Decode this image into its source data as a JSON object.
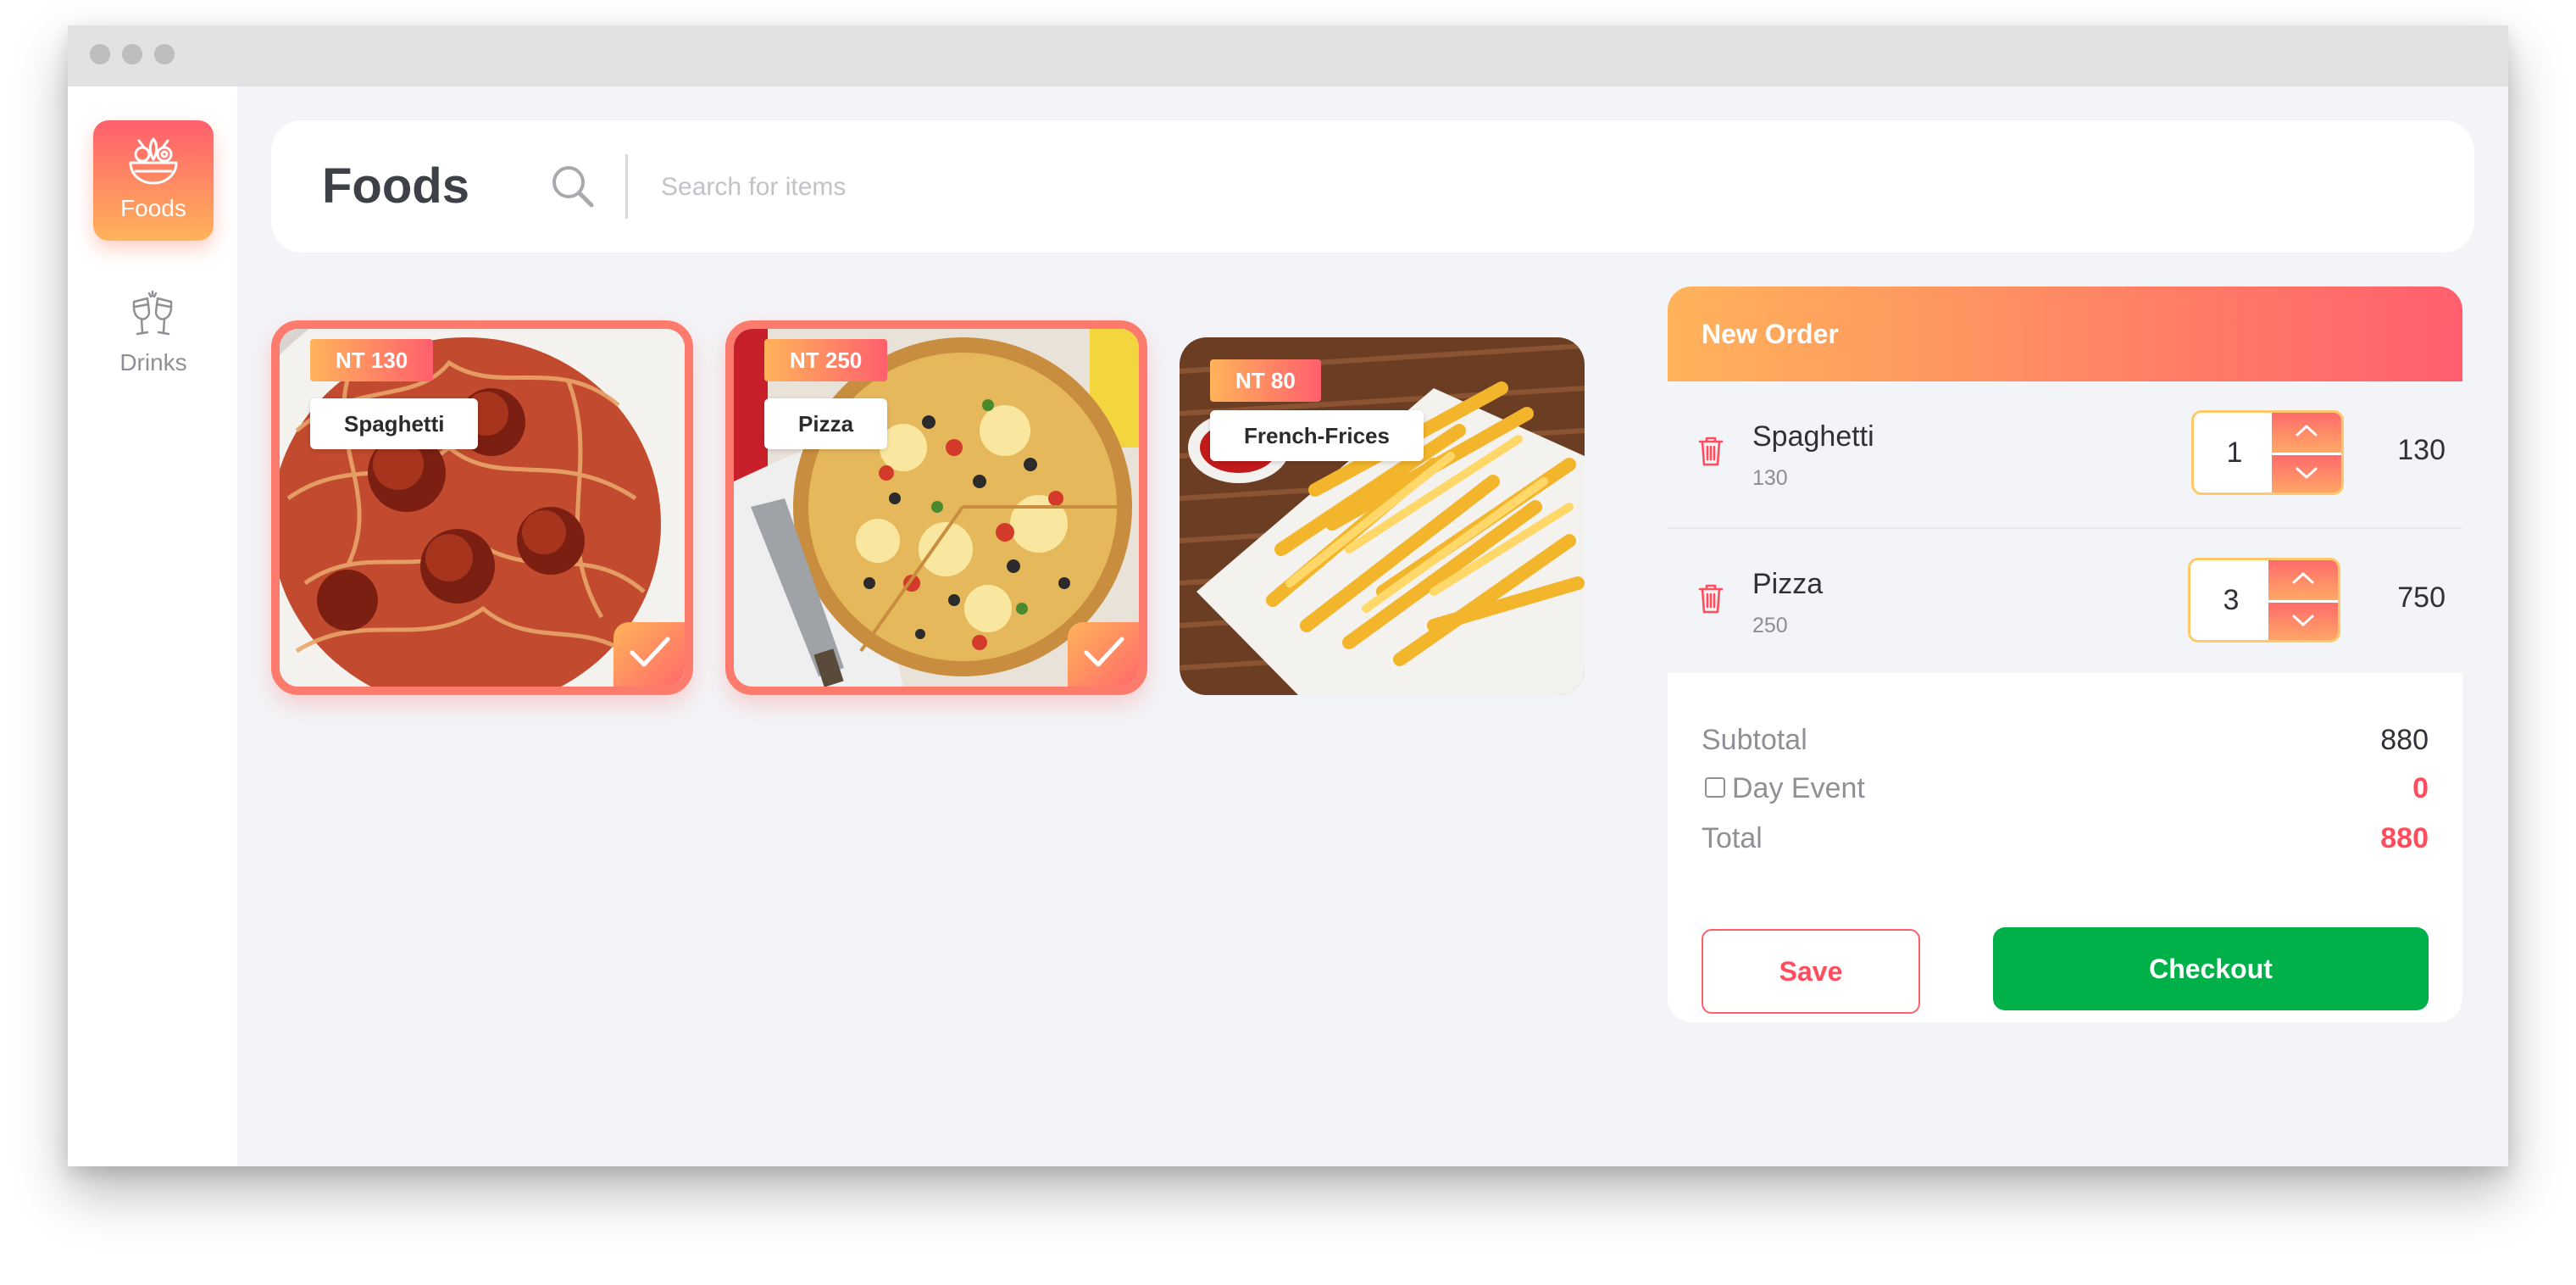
{
  "window": {
    "controls": [
      "close-dot",
      "minimize-dot",
      "maximize-dot"
    ]
  },
  "sidebar": {
    "items": [
      {
        "label": "Foods",
        "icon": "salad-bowl-icon",
        "active": true
      },
      {
        "label": "Drinks",
        "icon": "wine-glasses-icon",
        "active": false
      }
    ]
  },
  "header": {
    "title": "Foods",
    "search_placeholder": "Search for items",
    "search_icon": "search-icon"
  },
  "foods": [
    {
      "price": "NT 130",
      "name": "Spaghetti",
      "selected": true
    },
    {
      "price": "NT 250",
      "name": "Pizza",
      "selected": true
    },
    {
      "price": "NT 80",
      "name": "French-Frices",
      "selected": false
    }
  ],
  "order": {
    "title": "New Order",
    "items": [
      {
        "name": "Spaghetti",
        "unit_price": "130",
        "quantity": "1",
        "total": "130"
      },
      {
        "name": "Pizza",
        "unit_price": "250",
        "quantity": "3",
        "total": "750"
      }
    ],
    "subtotal_label": "Subtotal",
    "subtotal": "880",
    "day_event_label": "Day Event",
    "day_event_value": "0",
    "day_event_checked": false,
    "total_label": "Total",
    "total": "880",
    "save_label": "Save",
    "checkout_label": "Checkout"
  },
  "colors": {
    "accent_gradient_start": "#ffb35a",
    "accent_gradient_end": "#ff5f6d",
    "accent_red": "#ff4d5e",
    "checkout_green": "#00b14a",
    "background": "#f3f4f8"
  }
}
